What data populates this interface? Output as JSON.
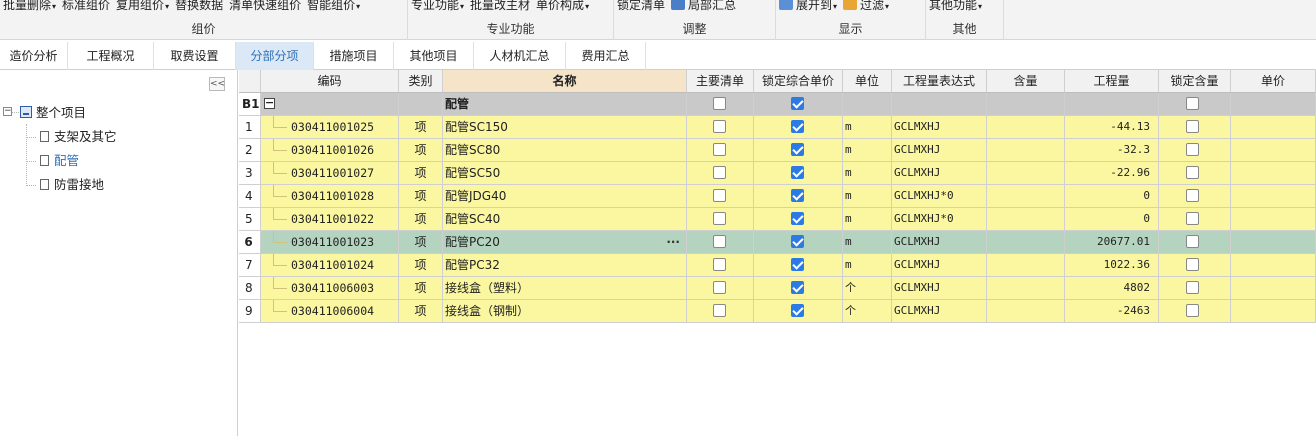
{
  "ribbon": {
    "groups": [
      {
        "buttons": [
          {
            "label": "批量删除",
            "dropdown": true
          },
          {
            "label": "标准组价",
            "dropdown": false
          },
          {
            "label": "复用组价",
            "dropdown": true
          },
          {
            "label": "替换数据",
            "dropdown": false
          },
          {
            "label": "清单快速组价",
            "dropdown": false
          },
          {
            "label": "智能组价",
            "dropdown": true
          }
        ],
        "title": "组价"
      },
      {
        "buttons": [
          {
            "label": "专业功能",
            "dropdown": true
          },
          {
            "label": "批量改主材",
            "dropdown": false
          },
          {
            "label": "单价构成",
            "dropdown": true
          }
        ],
        "title": "专业功能"
      },
      {
        "buttons": [
          {
            "label": "锁定清单",
            "dropdown": false
          },
          {
            "label": "局部汇总",
            "dropdown": false
          }
        ],
        "title": "调整"
      },
      {
        "buttons": [
          {
            "label": "展开到",
            "dropdown": true
          },
          {
            "label": "过滤",
            "dropdown": true
          }
        ],
        "title": "显示"
      },
      {
        "buttons": [
          {
            "label": "其他功能",
            "dropdown": true
          }
        ],
        "title": "其他"
      }
    ]
  },
  "tabs": [
    {
      "label": "造价分析",
      "active": false
    },
    {
      "label": "工程概况",
      "active": false
    },
    {
      "label": "取费设置",
      "active": false
    },
    {
      "label": "分部分项",
      "active": true
    },
    {
      "label": "措施项目",
      "active": false
    },
    {
      "label": "其他项目",
      "active": false
    },
    {
      "label": "人材机汇总",
      "active": false
    },
    {
      "label": "费用汇总",
      "active": false
    }
  ],
  "tree": {
    "collapse_glyph": "<<",
    "root": {
      "label": "整个项目",
      "toggle": "−"
    },
    "children": [
      {
        "label": "支架及其它",
        "selected": false
      },
      {
        "label": "配管",
        "selected": true
      },
      {
        "label": "防雷接地",
        "selected": false
      }
    ]
  },
  "grid": {
    "columns": [
      "编码",
      "类别",
      "名称",
      "主要清单",
      "锁定综合单价",
      "单位",
      "工程量表达式",
      "含量",
      "工程量",
      "锁定含量",
      "单价"
    ],
    "group_row": {
      "rn": "B1",
      "name": "配管",
      "main_list": false,
      "lock_price": true,
      "lock_content": false
    },
    "rows": [
      {
        "rn": "1",
        "code": "030411001025",
        "type": "项",
        "name": "配管SC150",
        "main_list": false,
        "lock_price": true,
        "unit": "m",
        "expr": "GCLMXHJ",
        "content": "",
        "qty": "-44.13",
        "lock_content": false,
        "selected": false
      },
      {
        "rn": "2",
        "code": "030411001026",
        "type": "项",
        "name": "配管SC80",
        "main_list": false,
        "lock_price": true,
        "unit": "m",
        "expr": "GCLMXHJ",
        "content": "",
        "qty": "-32.3",
        "lock_content": false,
        "selected": false
      },
      {
        "rn": "3",
        "code": "030411001027",
        "type": "项",
        "name": "配管SC50",
        "main_list": false,
        "lock_price": true,
        "unit": "m",
        "expr": "GCLMXHJ",
        "content": "",
        "qty": "-22.96",
        "lock_content": false,
        "selected": false
      },
      {
        "rn": "4",
        "code": "030411001028",
        "type": "项",
        "name": "配管JDG40",
        "main_list": false,
        "lock_price": true,
        "unit": "m",
        "expr": "GCLMXHJ*0",
        "content": "",
        "qty": "0",
        "lock_content": false,
        "selected": false
      },
      {
        "rn": "5",
        "code": "030411001022",
        "type": "项",
        "name": "配管SC40",
        "main_list": false,
        "lock_price": true,
        "unit": "m",
        "expr": "GCLMXHJ*0",
        "content": "",
        "qty": "0",
        "lock_content": false,
        "selected": false
      },
      {
        "rn": "6",
        "code": "030411001023",
        "type": "项",
        "name": "配管PC20",
        "main_list": false,
        "lock_price": true,
        "unit": "m",
        "expr": "GCLMXHJ",
        "content": "",
        "qty": "20677.01",
        "lock_content": false,
        "selected": true,
        "ellipsis": "···"
      },
      {
        "rn": "7",
        "code": "030411001024",
        "type": "项",
        "name": "配管PC32",
        "main_list": false,
        "lock_price": true,
        "unit": "m",
        "expr": "GCLMXHJ",
        "content": "",
        "qty": "1022.36",
        "lock_content": false,
        "selected": false
      },
      {
        "rn": "8",
        "code": "030411006003",
        "type": "项",
        "name": "接线盒（塑料）",
        "main_list": false,
        "lock_price": true,
        "unit": "个",
        "expr": "GCLMXHJ",
        "content": "",
        "qty": "4802",
        "lock_content": false,
        "selected": false
      },
      {
        "rn": "9",
        "code": "030411006004",
        "type": "项",
        "name": "接线盒（钢制）",
        "main_list": false,
        "lock_price": true,
        "unit": "个",
        "expr": "GCLMXHJ",
        "content": "",
        "qty": "-2463",
        "lock_content": false,
        "selected": false
      }
    ]
  },
  "colors": {
    "row_fill": "#fbf7a0",
    "selected_row_fill": "#b4d4c0",
    "group_fill": "#c9c9c9",
    "active_tab": "#dbe9f7",
    "checkbox_on": "#2c7be5"
  }
}
